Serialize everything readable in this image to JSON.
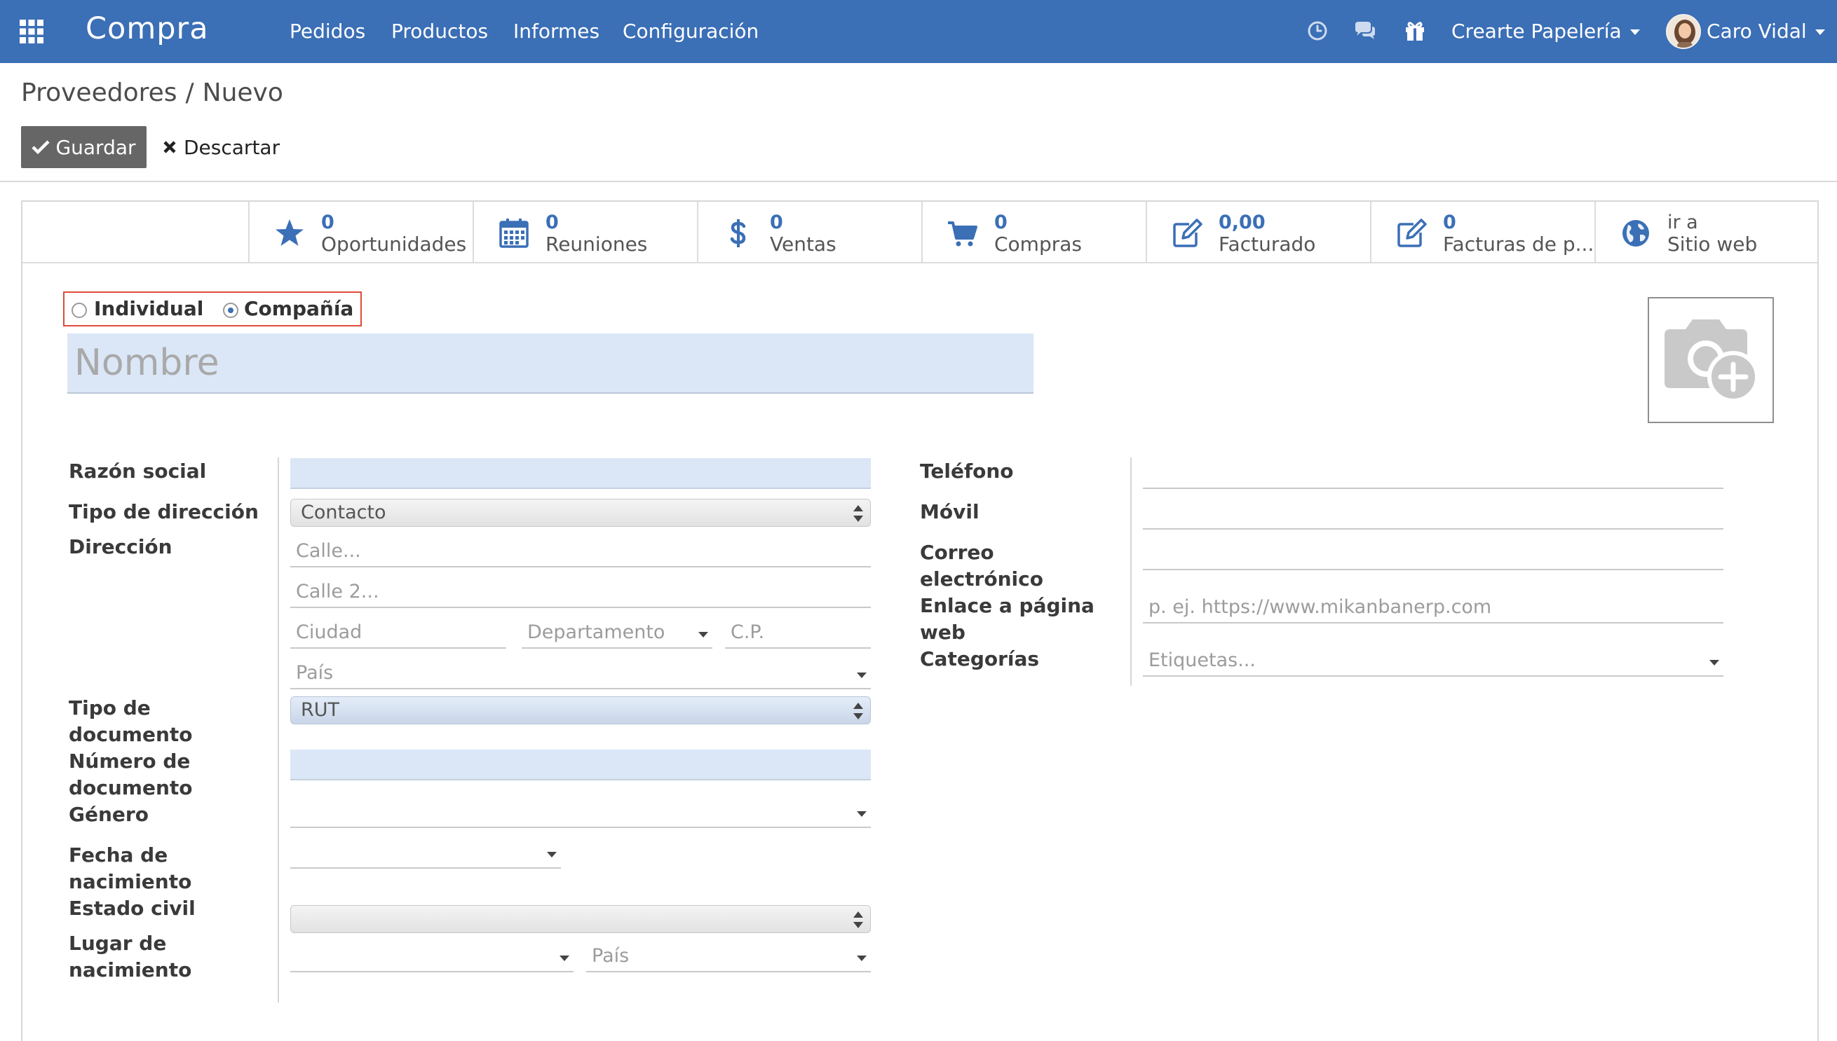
{
  "navbar": {
    "app_name": "Compra",
    "menu": [
      "Pedidos",
      "Productos",
      "Informes",
      "Configuración"
    ],
    "company": "Crearte Papelería",
    "user": "Caro Vidal"
  },
  "control_panel": {
    "breadcrumb_parent": "Proveedores",
    "breadcrumb_separator": "/",
    "breadcrumb_current": "Nuevo",
    "save_label": "Guardar",
    "discard_label": "Descartar"
  },
  "smart_buttons": [
    {
      "value": "0",
      "label": "Oportunidades",
      "icon": "star-icon"
    },
    {
      "value": "0",
      "label": "Reuniones",
      "icon": "calendar-icon"
    },
    {
      "value": "0",
      "label": "Ventas",
      "icon": "dollar-icon"
    },
    {
      "value": "0",
      "label": "Compras",
      "icon": "cart-icon"
    },
    {
      "value": "0,00",
      "label": "Facturado",
      "icon": "edit-icon"
    },
    {
      "value": "0",
      "label": "Facturas de p...",
      "icon": "edit-icon"
    },
    {
      "value": "ir a",
      "label": "Sitio web",
      "icon": "globe-icon"
    }
  ],
  "company_type": {
    "individual": "Individual",
    "company": "Compañía",
    "selected": "company"
  },
  "name_placeholder": "Nombre",
  "left": {
    "razon_social": "Razón social",
    "tipo_direccion": "Tipo de dirección",
    "tipo_direccion_value": "Contacto",
    "direccion": "Dirección",
    "street_placeholder": "Calle...",
    "street2_placeholder": "Calle 2...",
    "city_placeholder": "Ciudad",
    "state_placeholder": "Departamento",
    "zip_placeholder": "C.P.",
    "country_placeholder": "País",
    "tipo_documento_1": "Tipo de",
    "tipo_documento_2": "documento",
    "tipo_documento_value": "RUT",
    "numero_documento_1": "Número de",
    "numero_documento_2": "documento",
    "genero": "Género",
    "fecha_nacimiento_1": "Fecha de",
    "fecha_nacimiento_2": "nacimiento",
    "estado_civil": "Estado civil",
    "lugar_nacimiento_1": "Lugar de",
    "lugar_nacimiento_2": "nacimiento",
    "lugar_pais_placeholder": "País"
  },
  "right": {
    "telefono": "Teléfono",
    "movil": "Móvil",
    "correo_1": "Correo",
    "correo_2": "electrónico",
    "web_1": "Enlace a página",
    "web_2": "web",
    "web_placeholder": "p. ej. https://www.mikanbanerp.com",
    "categorias": "Categorías",
    "categorias_placeholder": "Etiquetas..."
  }
}
